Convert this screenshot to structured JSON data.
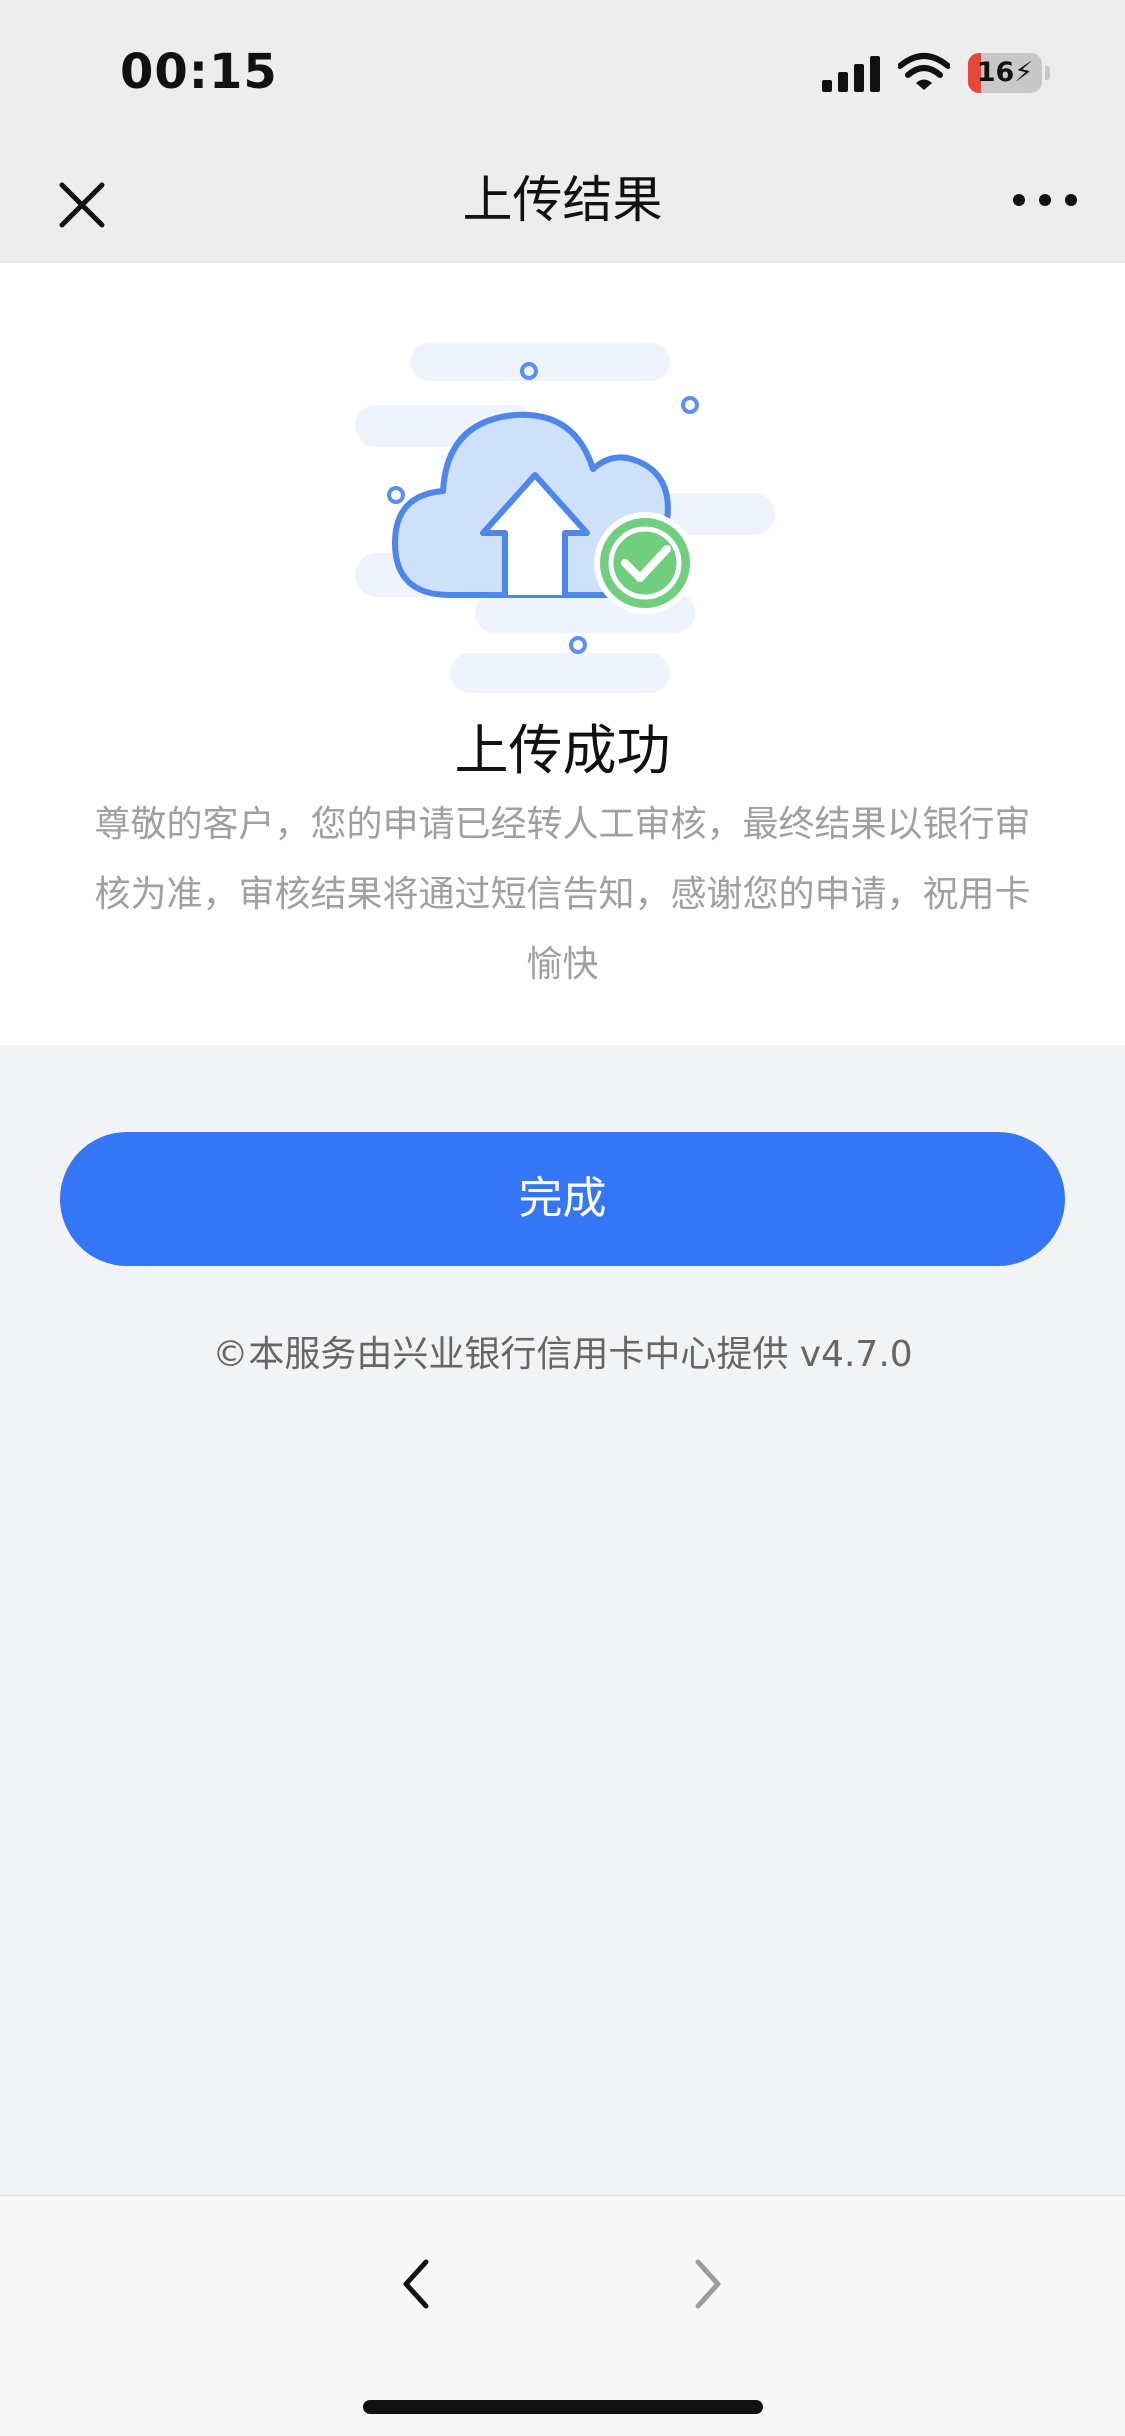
{
  "status_bar": {
    "time": "00:15",
    "battery": "16",
    "icons": [
      "signal-icon",
      "wifi-icon",
      "battery-icon"
    ]
  },
  "nav": {
    "title": "上传结果",
    "left_icon": "close-icon",
    "right_icon": "more-icon"
  },
  "result": {
    "title": "上传成功",
    "description": "尊敬的客户，您的申请已经转人工审核，最终结果以银行审核为准，审核结果将通过短信告知，感谢您的申请，祝用卡愉快"
  },
  "actions": {
    "done_label": "完成"
  },
  "footer": {
    "text": "©本服务由兴业银行信用卡中心提供 v4.7.0"
  },
  "browser_nav": {
    "back_icon": "chevron-left-icon",
    "forward_icon": "chevron-right-icon"
  },
  "colors": {
    "accent": "#3476f5",
    "success": "#4caf50",
    "battery_low": "#e5483b"
  }
}
